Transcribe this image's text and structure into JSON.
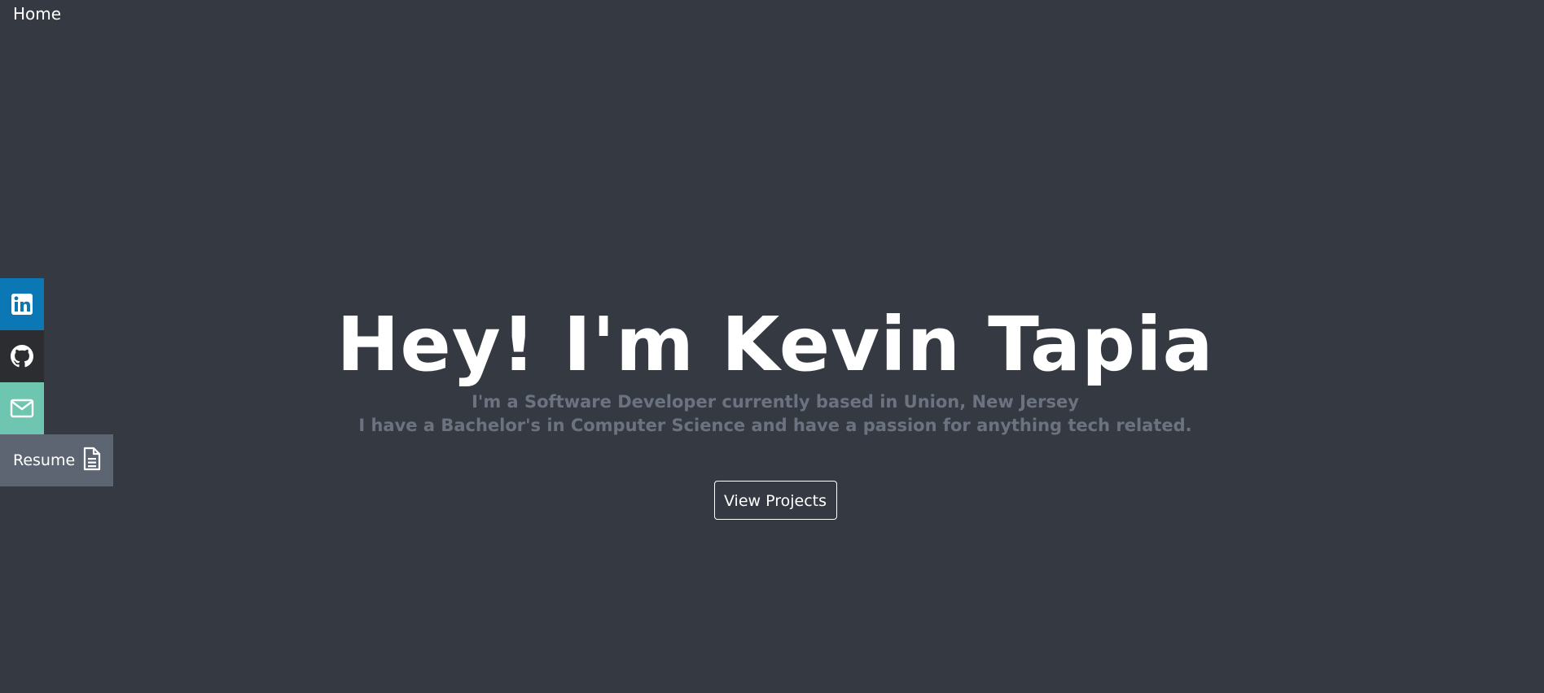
{
  "nav": {
    "home_label": "Home"
  },
  "social": {
    "items": [
      {
        "name": "linkedin",
        "icon": "linkedin-icon",
        "color": "#0b77b5"
      },
      {
        "name": "github",
        "icon": "github-icon",
        "color": "#2c2d30"
      },
      {
        "name": "email",
        "icon": "envelope-icon",
        "color": "#6ec5b0"
      }
    ],
    "resume": {
      "label": "Resume",
      "icon": "document-icon",
      "color": "#5e6572"
    }
  },
  "hero": {
    "title": "Hey! I'm Kevin Tapia",
    "subtitle_line1": "I'm a Software Developer currently based in Union, New Jersey",
    "subtitle_line2": "I have a Bachelor's in Computer Science and have a passion for anything tech related.",
    "cta_label": "View Projects"
  },
  "colors": {
    "background": "#353a42",
    "text": "#ffffff",
    "subtitle": "#6c7380"
  }
}
